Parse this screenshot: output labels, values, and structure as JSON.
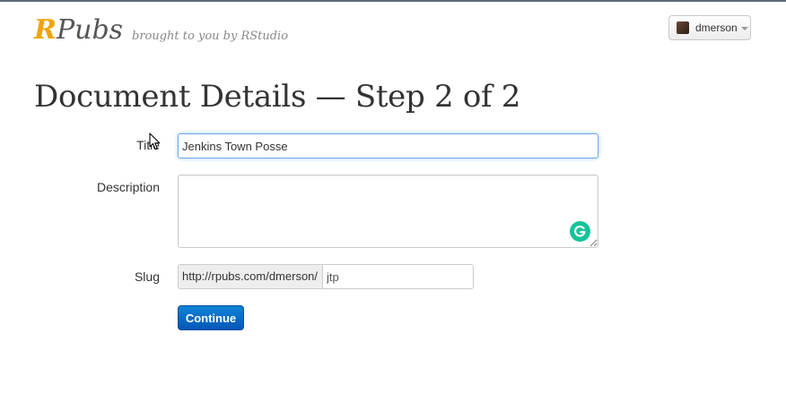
{
  "header": {
    "logo_r": "R",
    "logo_rest": "Pubs",
    "tagline": "brought to you by RStudio",
    "user": {
      "name": "dmerson"
    }
  },
  "page": {
    "title": "Document Details — Step 2 of 2"
  },
  "form": {
    "title_label": "Title",
    "title_value": "Jenkins Town Posse",
    "description_label": "Description",
    "description_value": "",
    "slug_label": "Slug",
    "slug_prefix": "http://rpubs.com/dmerson/",
    "slug_value": "jtp",
    "submit_label": "Continue"
  },
  "colors": {
    "logo_accent": "#f0a30a",
    "button_primary": "#0a6fcd",
    "focus_ring": "#6fa7e6",
    "grammarly": "#15c39a"
  },
  "icons": {
    "grammarly": "grammarly-icon",
    "cursor": "mouse-cursor-icon",
    "dropdown": "caret-down-icon"
  }
}
